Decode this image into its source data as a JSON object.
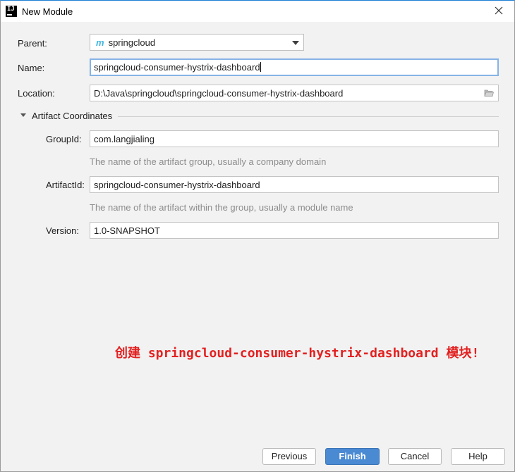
{
  "window": {
    "title": "New Module",
    "app_icon_text": "IJ"
  },
  "form": {
    "parent_label": "Parent:",
    "parent_value": "springcloud",
    "parent_icon_letter": "m",
    "name_label": "Name:",
    "name_value": "springcloud-consumer-hystrix-dashboard",
    "location_label": "Location:",
    "location_value": "D:\\Java\\springcloud\\springcloud-consumer-hystrix-dashboard"
  },
  "artifact": {
    "section_title": "Artifact Coordinates",
    "groupid_label": "GroupId:",
    "groupid_value": "com.langjialing",
    "groupid_hint": "The name of the artifact group, usually a company domain",
    "artifactid_label": "ArtifactId:",
    "artifactid_value": "springcloud-consumer-hystrix-dashboard",
    "artifactid_hint": "The name of the artifact within the group, usually a module name",
    "version_label": "Version:",
    "version_value": "1.0-SNAPSHOT"
  },
  "annotation": {
    "text": "创建 springcloud-consumer-hystrix-dashboard 模块!"
  },
  "buttons": {
    "previous": "Previous",
    "finish": "Finish",
    "cancel": "Cancel",
    "help": "Help"
  },
  "colors": {
    "accent": "#4a8ad3",
    "annotation": "#e32020",
    "focus_border": "#86b3e6",
    "hint_text": "#8c8c8c"
  }
}
